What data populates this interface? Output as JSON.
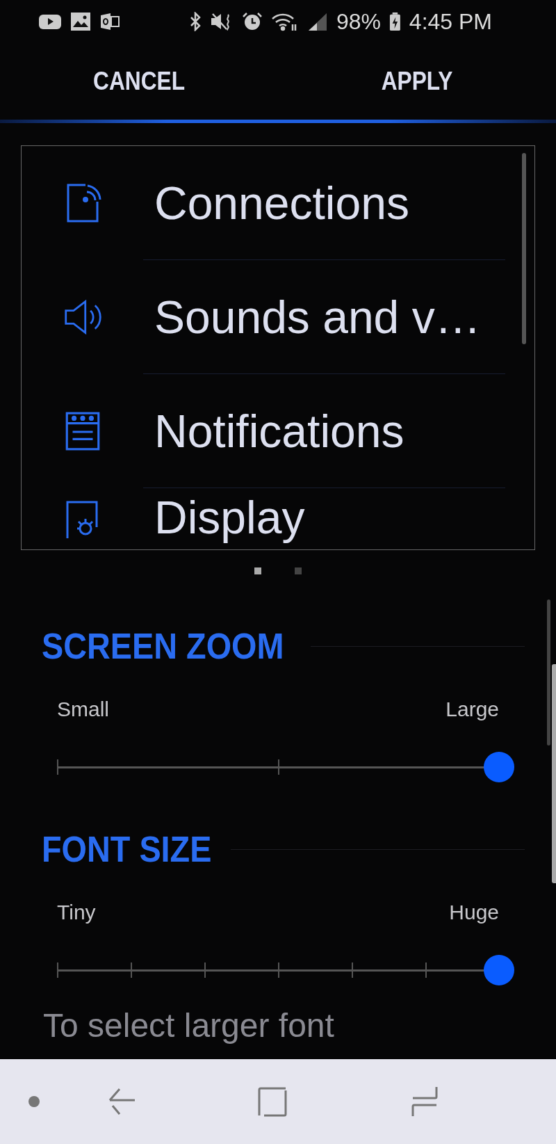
{
  "status_bar": {
    "battery": "98%",
    "time": "4:45 PM"
  },
  "header": {
    "cancel": "CANCEL",
    "apply": "APPLY"
  },
  "preview": {
    "items": [
      {
        "kind": "connections",
        "label": "Connections"
      },
      {
        "kind": "sounds",
        "label": "Sounds and v…"
      },
      {
        "kind": "notifications",
        "label": "Notifications"
      },
      {
        "kind": "display",
        "label": "Display"
      }
    ],
    "page_dots": [
      {
        "selected": true
      },
      {
        "selected": false
      }
    ]
  },
  "sections": [
    {
      "kind": "zoom",
      "title": "SCREEN ZOOM",
      "min_label": "Small",
      "max_label": "Large",
      "level": 1
    },
    {
      "kind": "font",
      "title": "FONT SIZE",
      "min_label": "Tiny",
      "max_label": "Huge",
      "level": 1
    }
  ],
  "hint": "To select larger font"
}
